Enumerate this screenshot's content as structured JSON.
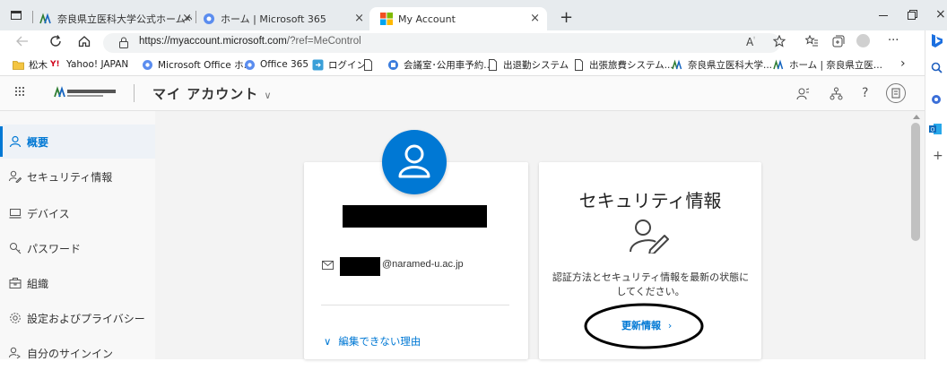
{
  "tabs": [
    {
      "label": "奈良県立医科大学公式ホームページ",
      "close": "×"
    },
    {
      "label": "ホーム | Microsoft 365",
      "close": "×"
    },
    {
      "label": "My Account",
      "close": "×"
    }
  ],
  "new_tab": "+",
  "address": {
    "host": "https://myaccount.microsoft.com",
    "path": "/?ref=MeControl"
  },
  "bookmarks": [
    {
      "label": "松木",
      "icon": "folder-icon"
    },
    {
      "label": "Yahoo! JAPAN",
      "icon": "yahoo-icon"
    },
    {
      "label": "Microsoft Office ホ...",
      "icon": "office-icon"
    },
    {
      "label": "Office 365",
      "icon": "office-icon"
    },
    {
      "label": "ログイン",
      "icon": "login-icon"
    },
    {
      "label": "",
      "icon": "page-icon"
    },
    {
      "label": "会議室･公用車予約...",
      "icon": "app-icon"
    },
    {
      "label": "出退勤システム",
      "icon": "page-icon"
    },
    {
      "label": "出張旅費システム...",
      "icon": "page-icon"
    },
    {
      "label": "奈良県立医科大学...",
      "icon": "university-icon"
    },
    {
      "label": "ホーム | 奈良県立医...",
      "icon": "university-icon"
    }
  ],
  "header": {
    "title": "マイ アカウント"
  },
  "sidebar": {
    "items": [
      {
        "label": "概要",
        "icon": "person-icon"
      },
      {
        "label": "セキュリティ情報",
        "icon": "security-info-icon"
      },
      {
        "label": "デバイス",
        "icon": "device-icon"
      },
      {
        "label": "パスワード",
        "icon": "key-icon"
      },
      {
        "label": "組織",
        "icon": "organization-icon"
      },
      {
        "label": "設定およびプライバシー",
        "icon": "settings-icon"
      },
      {
        "label": "自分のサインイン",
        "icon": "signin-icon"
      }
    ]
  },
  "profile_card": {
    "email": "@naramed-u.ac.jp",
    "link": "編集できない理由"
  },
  "security_card": {
    "title": "セキュリティ情報",
    "description": "認証方法とセキュリティ情報を最新の状態にしてください。",
    "action": "更新情報",
    "chevron": "›"
  },
  "colors": {
    "accent": "#0078d4",
    "avatar": "#0078d4",
    "redaction": "#000000"
  }
}
